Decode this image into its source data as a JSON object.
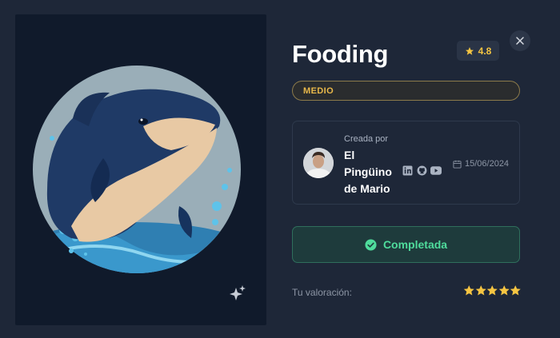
{
  "title": "Fooding",
  "rating": {
    "value": "4.8",
    "icon": "star-icon",
    "color": "#f5c542"
  },
  "level": {
    "label": "MEDIO"
  },
  "creator": {
    "label": "Creada por",
    "name": "El Pingüino de Mario",
    "socials": [
      "linkedin-icon",
      "github-icon",
      "youtube-icon"
    ],
    "date": "15/06/2024"
  },
  "status": {
    "label": "Completada",
    "icon": "check-circle-icon",
    "color": "#4fdc9c"
  },
  "user_rating": {
    "label": "Tu valoración:",
    "stars": 5,
    "max": 5
  }
}
